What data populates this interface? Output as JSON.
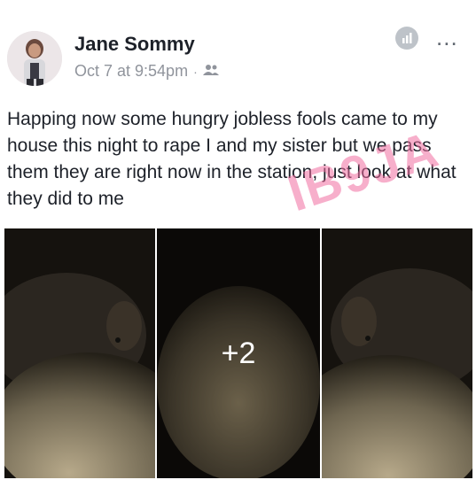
{
  "post": {
    "author": "Jane Sommy",
    "timestamp": "Oct 7 at 9:54pm",
    "separator": "·",
    "audience_icon": "friends-icon",
    "text": "Happing now some hungry jobless fools came to my house this night to rape I and my sister but we pass them they are right now in the station, just look at what they did to me",
    "watermark": "IB9JA",
    "more_label": "...",
    "photos": {
      "extra_count_label": "+2"
    }
  }
}
